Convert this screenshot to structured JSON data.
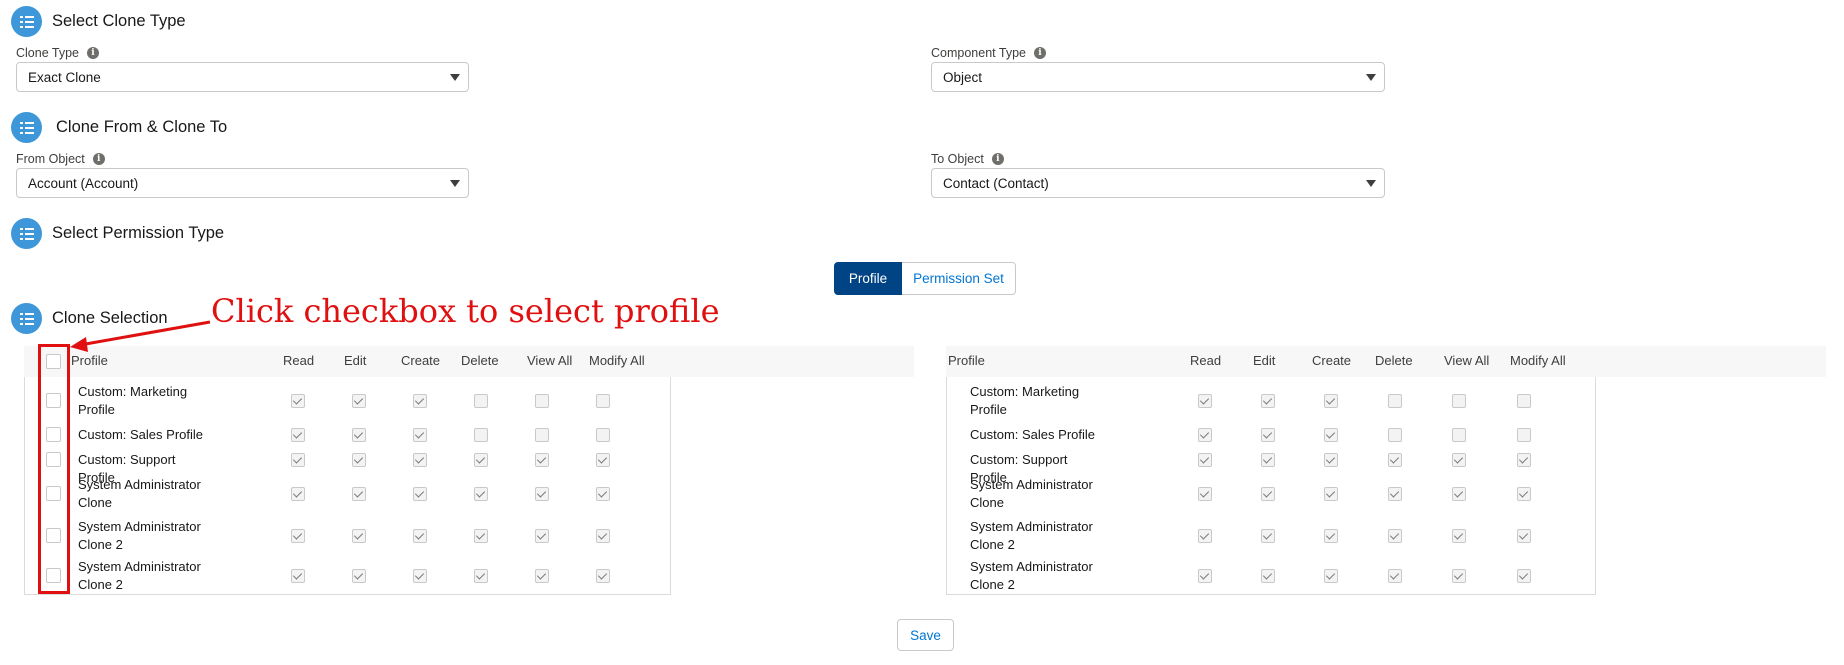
{
  "sections": {
    "clone_type": "Select Clone Type",
    "clone_from_to": "Clone From & Clone To",
    "permission_type": "Select Permission Type",
    "clone_selection": "Clone Selection"
  },
  "fields": {
    "clone_type": {
      "label": "Clone Type",
      "value": "Exact Clone"
    },
    "component_type": {
      "label": "Component Type",
      "value": "Object"
    },
    "from_object": {
      "label": "From Object",
      "value": "Account (Account)"
    },
    "to_object": {
      "label": "To Object",
      "value": "Contact (Contact)"
    }
  },
  "permission_toggle": {
    "profile": "Profile",
    "permission_set": "Permission Set",
    "selected": "Profile"
  },
  "annotation": {
    "text": "Click checkbox to select profile",
    "color": "#e01010"
  },
  "columns": [
    "Profile",
    "Read",
    "Edit",
    "Create",
    "Delete",
    "View All",
    "Modify All"
  ],
  "left_table": {
    "rows": [
      {
        "name": "Custom: Marketing Profile",
        "perms": [
          true,
          true,
          true,
          false,
          false,
          false
        ]
      },
      {
        "name": "Custom: Sales Profile",
        "perms": [
          true,
          true,
          true,
          false,
          false,
          false
        ]
      },
      {
        "name": "Custom: Support Profile",
        "perms": [
          true,
          true,
          true,
          true,
          true,
          true
        ]
      },
      {
        "name": "System Administrator Clone",
        "perms": [
          true,
          true,
          true,
          true,
          true,
          true
        ]
      },
      {
        "name": "System Administrator Clone 2",
        "perms": [
          true,
          true,
          true,
          true,
          true,
          true
        ]
      },
      {
        "name": "System Administrator Clone 2",
        "perms": [
          true,
          true,
          true,
          true,
          true,
          true
        ]
      }
    ]
  },
  "right_table": {
    "rows": [
      {
        "name": "Custom: Marketing Profile",
        "perms": [
          true,
          true,
          true,
          false,
          false,
          false
        ]
      },
      {
        "name": "Custom: Sales Profile",
        "perms": [
          true,
          true,
          true,
          false,
          false,
          false
        ]
      },
      {
        "name": "Custom: Support Profile",
        "perms": [
          true,
          true,
          true,
          true,
          true,
          true
        ]
      },
      {
        "name": "System Administrator Clone",
        "perms": [
          true,
          true,
          true,
          true,
          true,
          true
        ]
      },
      {
        "name": "System Administrator Clone 2",
        "perms": [
          true,
          true,
          true,
          true,
          true,
          true
        ]
      },
      {
        "name": "System Administrator Clone 2",
        "perms": [
          true,
          true,
          true,
          true,
          true,
          true
        ]
      }
    ]
  },
  "save_label": "Save",
  "colors": {
    "brand": "#014486",
    "section_icon": "#3d97d9",
    "link": "#0176d3"
  }
}
